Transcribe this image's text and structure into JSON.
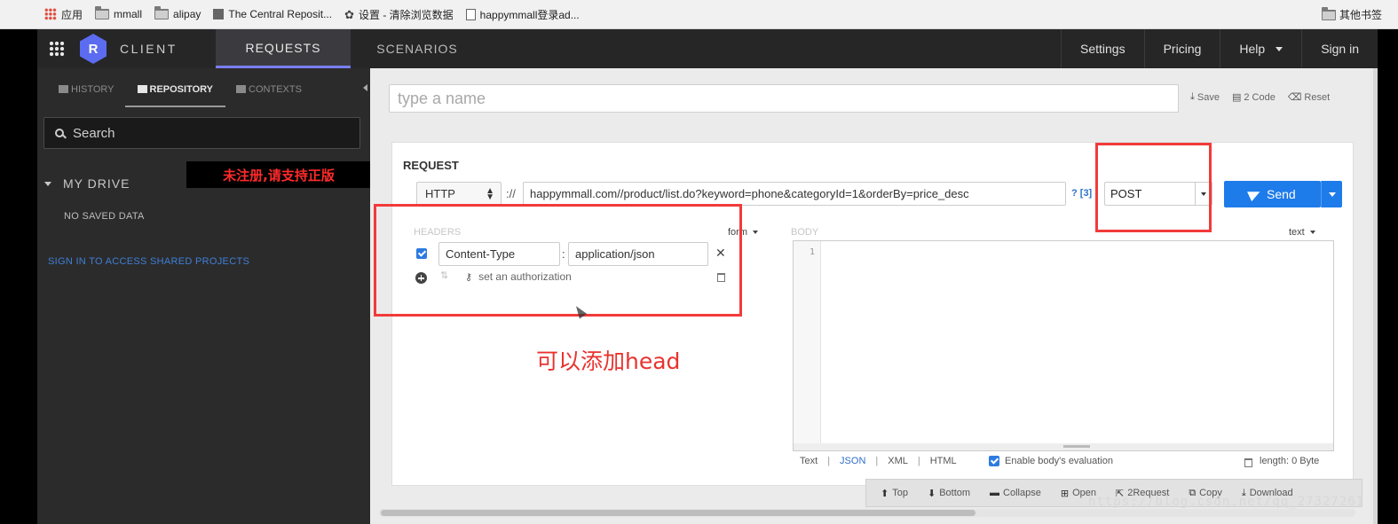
{
  "bookmarks": {
    "items": [
      {
        "label": "应用",
        "icon": "apps-icon"
      },
      {
        "label": "mmall",
        "icon": "folder-icon"
      },
      {
        "label": "alipay",
        "icon": "folder-icon"
      },
      {
        "label": "The Central Reposit...",
        "icon": "site-icon"
      },
      {
        "label": "设置 - 清除浏览数据",
        "icon": "gear-icon"
      },
      {
        "label": "happymmall登录ad...",
        "icon": "page-icon"
      }
    ],
    "other": "其他书签"
  },
  "app": {
    "brand": "CLIENT",
    "logo_letter": "R",
    "tabs": [
      "REQUESTS",
      "SCENARIOS"
    ],
    "active_tab": "REQUESTS",
    "top_links": {
      "settings": "Settings",
      "pricing": "Pricing",
      "help": "Help",
      "sign_in": "Sign in"
    },
    "accent_color": "#7a7ef5",
    "send_color": "#1e7bea"
  },
  "sidebar": {
    "tabs": [
      "HISTORY",
      "REPOSITORY",
      "CONTEXTS"
    ],
    "active_tab": "REPOSITORY",
    "search_placeholder": "Search",
    "drive_title": "MY DRIVE",
    "no_data": "NO SAVED DATA",
    "sign_in_shared": "SIGN IN TO ACCESS SHARED PROJECTS",
    "unregistered_notice": "未注册,请支持正版"
  },
  "main": {
    "name_placeholder": "type a name",
    "actions": {
      "save": "Save",
      "code": "2 Code",
      "reset": "Reset"
    },
    "request_title": "REQUEST",
    "scheme": "HTTP",
    "scheme_sep": "://",
    "url": "happymmall.com//product/list.do?keyword=phone&categoryId=1&orderBy=price_desc",
    "query_count": "? [3]",
    "method": "POST",
    "send_label": "Send",
    "headers_label": "HEADERS",
    "headers_mode": "form",
    "headers": [
      {
        "key": "Content-Type",
        "value": "application/json",
        "enabled": true
      }
    ],
    "auth_label": "set an authorization",
    "body_label": "BODY",
    "body_mode": "text",
    "line_number": "1",
    "formats": [
      "Text",
      "JSON",
      "XML",
      "HTML"
    ],
    "active_format": "JSON",
    "eval_label": "Enable body's evaluation",
    "length_label": "length: 0 Byte",
    "footer": {
      "top": "Top",
      "bottom": "Bottom",
      "collapse": "Collapse",
      "open": "Open",
      "to_request": "2Request",
      "copy": "Copy",
      "download": "Download"
    }
  },
  "annotation": {
    "text": "可以添加head",
    "highlight_color": "#f23a3a"
  },
  "watermark": "https://blog.csdn.net/qq_27327261"
}
